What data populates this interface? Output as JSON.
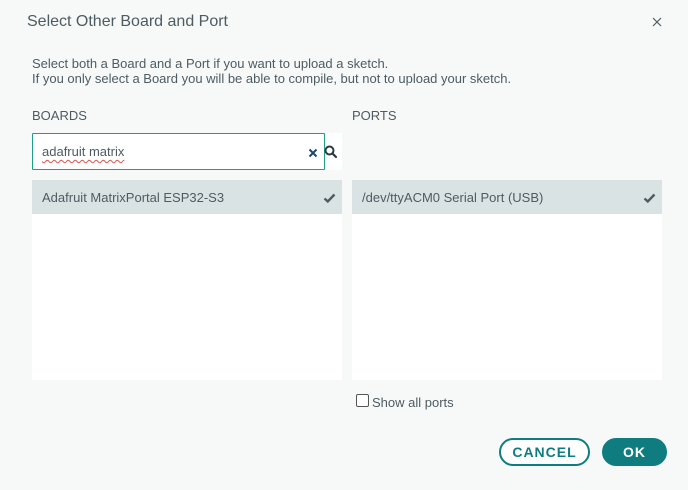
{
  "dialog": {
    "title": "Select Other Board and Port",
    "description_line1": "Select both a Board and a Port if you want to upload a sketch.",
    "description_line2": "If you only select a Board you will be able to compile, but not to upload your sketch."
  },
  "boards": {
    "label": "BOARDS",
    "search_value": "adafruit matrix",
    "items": [
      {
        "label": "Adafruit MatrixPortal ESP32-S3",
        "selected": true
      }
    ]
  },
  "ports": {
    "label": "PORTS",
    "items": [
      {
        "label": "/dev/ttyACM0 Serial Port (USB)",
        "selected": true
      }
    ],
    "show_all_label": "Show all ports",
    "show_all_checked": false
  },
  "buttons": {
    "cancel_label": "CANCEL",
    "ok_label": "OK"
  },
  "colors": {
    "accent": "#0f7c80",
    "selected_row": "#dae3e3",
    "focus_border": "#1da086"
  },
  "icons": {
    "close": "close-icon",
    "clear": "clear-icon",
    "search": "search-icon",
    "check": "check-icon"
  }
}
